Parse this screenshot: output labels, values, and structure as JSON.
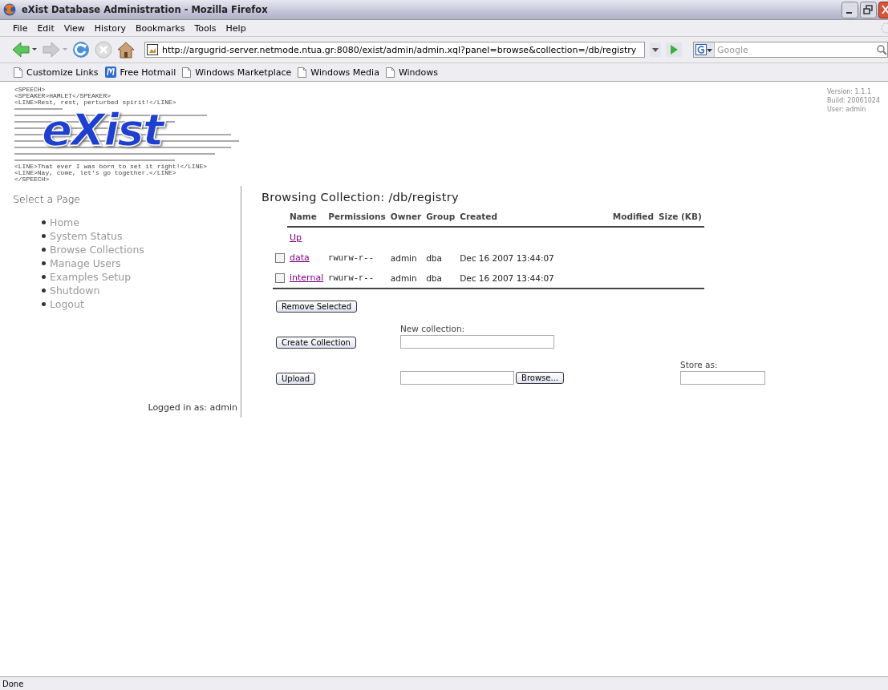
{
  "window": {
    "title": "eXist Database Administration - Mozilla Firefox"
  },
  "menu": [
    {
      "label": "File"
    },
    {
      "label": "Edit"
    },
    {
      "label": "View"
    },
    {
      "label": "History"
    },
    {
      "label": "Bookmarks"
    },
    {
      "label": "Tools"
    },
    {
      "label": "Help"
    }
  ],
  "navigation": {
    "url": "http://argugrid-server.netmode.ntua.gr:8080/exist/admin/admin.xql?panel=browse&collection=/db/registry",
    "search_placeholder": "Google"
  },
  "bookmarks": [
    {
      "label": "Customize Links",
      "kind": "page"
    },
    {
      "label": "Free Hotmail",
      "kind": "hotmail"
    },
    {
      "label": "Windows Marketplace",
      "kind": "page"
    },
    {
      "label": "Windows Media",
      "kind": "page"
    },
    {
      "label": "Windows",
      "kind": "page"
    }
  ],
  "logo": {
    "word": "eXist",
    "top_lines": [
      "<SPEECH>",
      "<SPEAKER>HAMLET</SPEAKER>",
      "<LINE>Rest, rest, perturbed spirit!</LINE>"
    ],
    "bottom_lines": [
      "<LINE>That ever I was born to set it right!</LINE>",
      "<LINE>Nay, come, let's go together.</LINE>",
      "</SPEECH>"
    ]
  },
  "server_info": [
    "Version: 1.1.1",
    "Build: 20061024",
    "User: admin"
  ],
  "sidebar": {
    "title": "Select a Page",
    "items": [
      "Home",
      "System Status",
      "Browse Collections",
      "Manage Users",
      "Examples Setup",
      "Shutdown",
      "Logout"
    ],
    "login": "Logged in as: admin"
  },
  "collection": {
    "heading": "Browsing Collection: /db/registry",
    "columns": [
      "Name",
      "Permissions",
      "Owner",
      "Group",
      "Created",
      "Modified",
      "Size (KB)"
    ],
    "up_link": "Up",
    "rows": [
      {
        "checked": false,
        "name": "data",
        "permissions": "rwurw-r--",
        "owner": "admin",
        "group": "dba",
        "created": "Dec 16 2007 13:44:07"
      },
      {
        "checked": false,
        "name": "internal",
        "permissions": "rwurw-r--",
        "owner": "admin",
        "group": "dba",
        "created": "Dec 16 2007 13:44:07"
      }
    ]
  },
  "actions": {
    "remove_button": "Remove Selected",
    "create_button": "Create Collection",
    "new_collection_label": "New collection:",
    "upload_button": "Upload",
    "browse_button": "Browse...",
    "store_as_label": "Store as:"
  },
  "status_bar": {
    "text": "Done"
  }
}
